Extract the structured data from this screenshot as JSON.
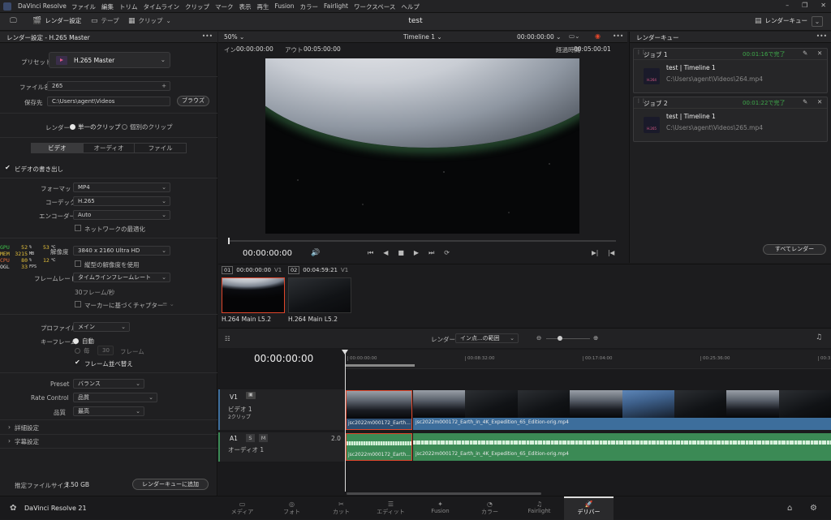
{
  "titlebar": {
    "app_name": "DaVinci Resolve",
    "menus": [
      "ファイル",
      "編集",
      "トリム",
      "タイムライン",
      "クリップ",
      "マーク",
      "表示",
      "再生",
      "Fusion",
      "カラー",
      "Fairlight",
      "ワークスペース",
      "ヘルプ"
    ]
  },
  "toolbar": {
    "render_settings": "レンダー設定",
    "tape": "テープ",
    "clip": "クリップ",
    "project_title": "test",
    "render_queue": "レンダーキュー"
  },
  "render_panel": {
    "header": "レンダー設定 - H.265 Master",
    "preset_label": "プリセット",
    "preset_value": "H.265 Master",
    "filename_label": "ファイル名",
    "filename_value": "265",
    "location_label": "保存先",
    "location_value": "C:\\Users\\agent\\Videos",
    "browse": "ブラウズ",
    "render_label": "レンダー",
    "single_clip": "単一のクリップ",
    "individual_clips": "個別のクリップ",
    "tabs": [
      "ビデオ",
      "オーディオ",
      "ファイル"
    ],
    "export_video": "ビデオの書き出し",
    "format_label": "フォーマット",
    "format_value": "MP4",
    "codec_label": "コーデック",
    "codec_value": "H.265",
    "encoder_label": "エンコーダー",
    "encoder_value": "Auto",
    "network_opt": "ネットワークの最適化",
    "resolution_label": "解像度",
    "resolution_value": "3840 x 2160 Ultra HD",
    "aspect_opt": "縦型の解像度を使用",
    "framerate_label": "フレームレート",
    "framerate_value": "タイムラインフレームレート",
    "framerate_note": "30フレーム/秒",
    "chapters": "マーカーに基づくチャプター",
    "profile_label": "プロファイル",
    "profile_value": "メイン",
    "keyframe_label": "キーフレーム",
    "keyframe_auto": "自動",
    "keyframe_every": "毎",
    "keyframe_every_num": "30",
    "keyframe_unit": "フレーム",
    "frame_reorder": "フレーム並べ替え",
    "preset2_label": "Preset",
    "preset2_value": "バランス",
    "rate_label": "Rate Control",
    "rate_value": "品質",
    "quality_label": "品質",
    "quality_value": "最高",
    "advanced": "詳細設定",
    "subtitles": "字幕設定",
    "est_size_label": "推定ファイルサイズ",
    "est_size_value": "3.50 GB",
    "add_queue": "レンダーキューに追加"
  },
  "hw_overlay": {
    "rows": [
      {
        "k": "GPU",
        "v": "52",
        "u": "%",
        "v2": "53",
        "u2": "℃"
      },
      {
        "k": "MEM",
        "v": "3215",
        "u": "MB",
        "v2": "",
        "u2": ""
      },
      {
        "k": "CPU",
        "v": "80",
        "u": "%",
        "v2": "12",
        "u2": "℃"
      },
      {
        "k": "OGL",
        "v": "33",
        "u": "FPS",
        "v2": "",
        "u2": ""
      }
    ]
  },
  "viewer": {
    "zoom": "50%",
    "timeline_name": "Timeline 1",
    "timecode_top": "00:00:00:00",
    "in_label": "イン",
    "in_value": "00:00:00:00",
    "out_label": "アウト",
    "out_value": "00:05:00:00",
    "duration_label": "経過時間",
    "duration_value": "00:05:00:01",
    "current_tc": "00:00:00:00"
  },
  "clips": [
    {
      "index": "01",
      "tc": "00:00:00:00",
      "track": "V1",
      "name": "H.264 Main L5.2"
    },
    {
      "index": "02",
      "tc": "00:04:59:21",
      "track": "V1",
      "name": "H.264 Main L5.2"
    }
  ],
  "render_queue": {
    "header": "レンダーキュー",
    "jobs": [
      {
        "name": "ジョブ 1",
        "status": "00:01:16で完了",
        "title": "test | Timeline 1",
        "path": "C:\\Users\\agent\\Videos\\264.mp4",
        "badge": "H.264"
      },
      {
        "name": "ジョブ 2",
        "status": "00:01:22で完了",
        "title": "test | Timeline 1",
        "path": "C:\\Users\\agent\\Videos\\265.mp4",
        "badge": "H.265"
      }
    ],
    "render_all": "すべてレンダー"
  },
  "timeline": {
    "render_label": "レンダー",
    "range_value": "イン点...の範囲",
    "timecode": "00:00:00:00",
    "ruler": [
      "00:00:00:00",
      "00:08:32:00",
      "00:17:04:00",
      "00:25:36:00",
      "00:3"
    ],
    "v1_label": "V1",
    "v1_name": "ビデオ 1",
    "v1_sub": "2クリップ",
    "a1_label": "A1",
    "a1_s": "S",
    "a1_m": "M",
    "a1_level": "2.0",
    "a1_name": "オーディオ 1",
    "clip1_name": "jsc2022m000172_Earth...",
    "clip2_name": "jsc2022m000172_Earth_in_4K_Expedition_65_Edition-orig.mp4"
  },
  "pagebar": {
    "brand": "DaVinci Resolve 21",
    "pages": [
      "メディア",
      "フォト",
      "カット",
      "エディット",
      "Fusion",
      "カラー",
      "Fairlight",
      "デリバー"
    ],
    "active_index": 7
  },
  "colors": {
    "accent_red": "#e0462b",
    "complete_green": "#3ea84a",
    "clip_blue": "#3d6e9c",
    "audio_green": "#3b8a55"
  }
}
